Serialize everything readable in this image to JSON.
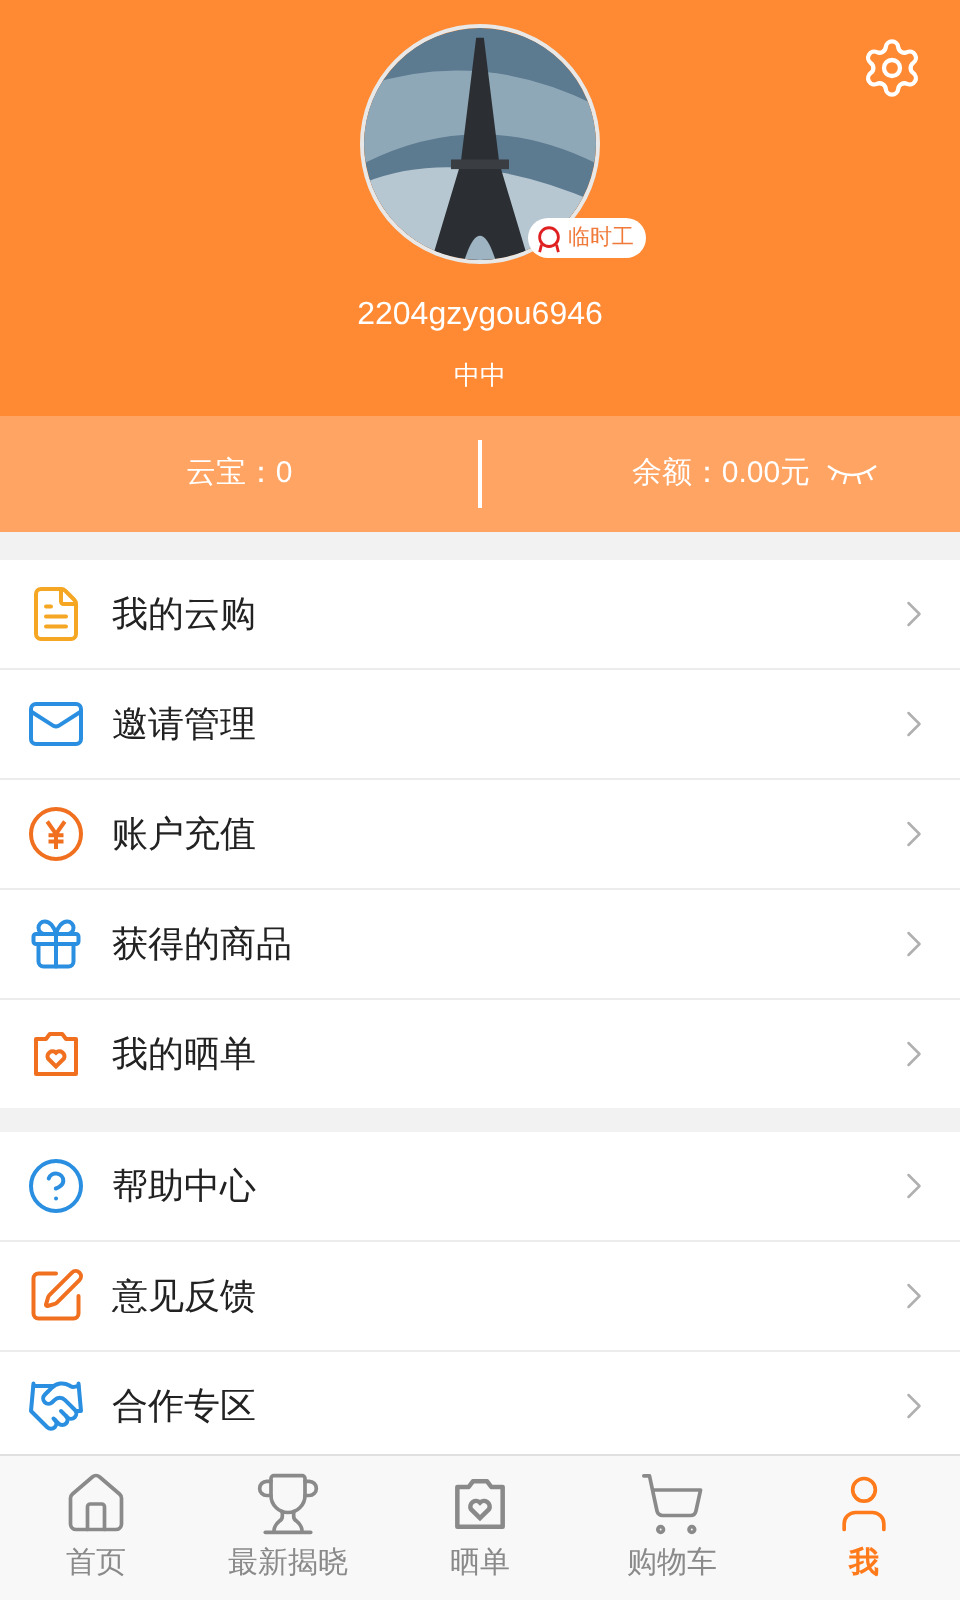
{
  "profile": {
    "username": "2204gzygou6946",
    "level": "中中",
    "badge": "临时工"
  },
  "stats": {
    "points": "云宝：0",
    "balance": "余额：0.00元",
    "balance_hidden": true
  },
  "menu_groups": [
    [
      {
        "label": "我的云购"
      },
      {
        "label": "邀请管理"
      },
      {
        "label": "账户充值"
      },
      {
        "label": "获得的商品"
      },
      {
        "label": "我的晒单"
      }
    ],
    [
      {
        "label": "帮助中心"
      },
      {
        "label": "意见反馈"
      },
      {
        "label": "合作专区"
      }
    ]
  ],
  "nav": [
    {
      "label": "首页",
      "selected": false
    },
    {
      "label": "最新揭晓",
      "selected": false
    },
    {
      "label": "晒单",
      "selected": false
    },
    {
      "label": "购物车",
      "selected": false
    },
    {
      "label": "我",
      "selected": true
    }
  ]
}
